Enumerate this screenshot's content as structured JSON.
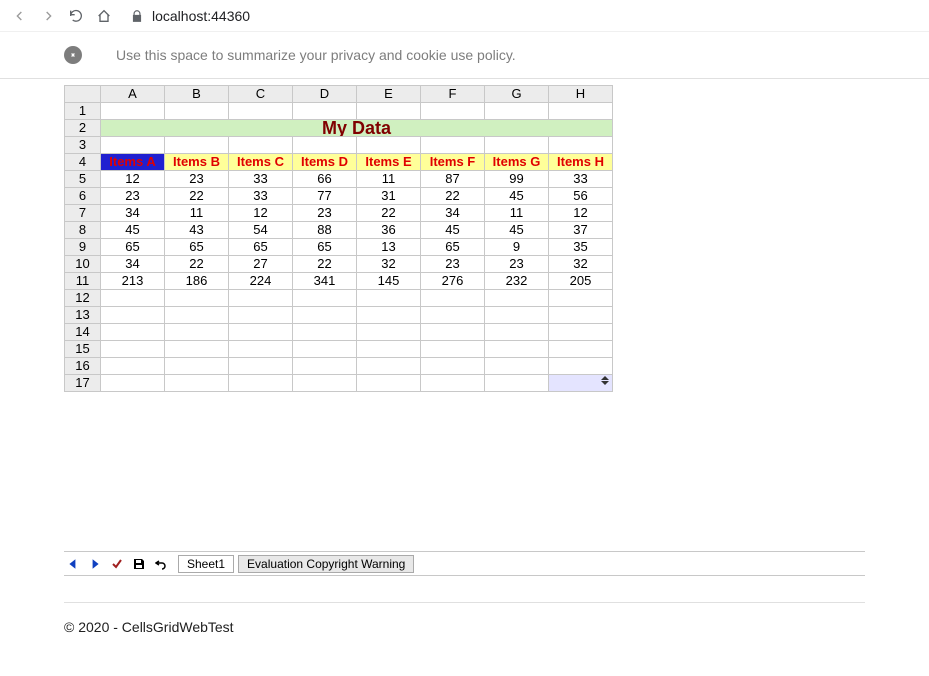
{
  "browser": {
    "url": "localhost:44360"
  },
  "privacy_notice": "Use this space to summarize your privacy and cookie use policy.",
  "sheet": {
    "columns": [
      "A",
      "B",
      "C",
      "D",
      "E",
      "F",
      "G",
      "H"
    ],
    "row_numbers": [
      1,
      2,
      3,
      4,
      5,
      6,
      7,
      8,
      9,
      10,
      11,
      12,
      13,
      14,
      15,
      16,
      17
    ],
    "title": "My Data",
    "headers": [
      "Items A",
      "Items B",
      "Items C",
      "Items D",
      "Items E",
      "Items F",
      "Items G",
      "Items H"
    ],
    "rows": [
      [
        12,
        23,
        33,
        66,
        11,
        87,
        99,
        33
      ],
      [
        23,
        22,
        33,
        77,
        31,
        22,
        45,
        56
      ],
      [
        34,
        11,
        12,
        23,
        22,
        34,
        11,
        12
      ],
      [
        45,
        43,
        54,
        88,
        36,
        45,
        45,
        37
      ],
      [
        65,
        65,
        65,
        65,
        13,
        65,
        9,
        35
      ],
      [
        34,
        22,
        27,
        22,
        32,
        23,
        23,
        32
      ]
    ],
    "totals": [
      213,
      186,
      224,
      341,
      145,
      276,
      232,
      205
    ]
  },
  "tabs": {
    "sheet_name": "Sheet1",
    "warning": "Evaluation Copyright Warning"
  },
  "footer": "© 2020 - CellsGridWebTest",
  "chart_data": {
    "type": "table",
    "title": "My Data",
    "columns": [
      "Items A",
      "Items B",
      "Items C",
      "Items D",
      "Items E",
      "Items F",
      "Items G",
      "Items H"
    ],
    "rows": [
      [
        12,
        23,
        33,
        66,
        11,
        87,
        99,
        33
      ],
      [
        23,
        22,
        33,
        77,
        31,
        22,
        45,
        56
      ],
      [
        34,
        11,
        12,
        23,
        22,
        34,
        11,
        12
      ],
      [
        45,
        43,
        54,
        88,
        36,
        45,
        45,
        37
      ],
      [
        65,
        65,
        65,
        65,
        13,
        65,
        9,
        35
      ],
      [
        34,
        22,
        27,
        22,
        32,
        23,
        23,
        32
      ]
    ],
    "totals": [
      213,
      186,
      224,
      341,
      145,
      276,
      232,
      205
    ]
  }
}
